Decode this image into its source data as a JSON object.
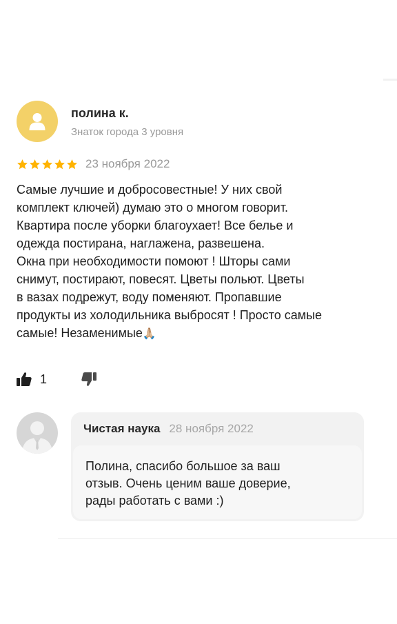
{
  "review": {
    "author_name": "полина к.",
    "author_level": "Знаток города 3 уровня",
    "rating": 5,
    "rating_max": 5,
    "date": "23 ноября 2022",
    "text": "Самые лучшие и добросовестные! У них свой\nкомплект ключей) думаю это о многом говорит.\nКвартира после уборки благоухает! Все белье и\nодежда постирана, наглажена, развешена.\nОкна при необходимости помоют ! Шторы сами\nснимут, постирают, повесят. Цветы польют. Цветы\nв вазах подрежут, воду поменяют. Пропавшие\nпродукты из холодильника выбросят ! Просто самые\nсамые! Незаменимые",
    "emoji": "🙏🏼",
    "likes": "1"
  },
  "reply": {
    "author": "Чистая наука",
    "date": "28 ноября 2022",
    "text": "Полина, спасибо большое за ваш\nотзыв. Очень ценим ваше доверие,\nрады работать с вами :)"
  },
  "colors": {
    "avatar_yellow": "#f3d168",
    "star_orange": "#ffb300",
    "muted_text": "#9a9a9a",
    "reply_card": "#f2f2f2"
  },
  "icons": {
    "avatar": "user-silhouette-icon",
    "star": "star-icon",
    "like": "thumbs-up-icon",
    "dislike": "thumbs-down-icon",
    "reply_avatar": "business-person-icon"
  }
}
